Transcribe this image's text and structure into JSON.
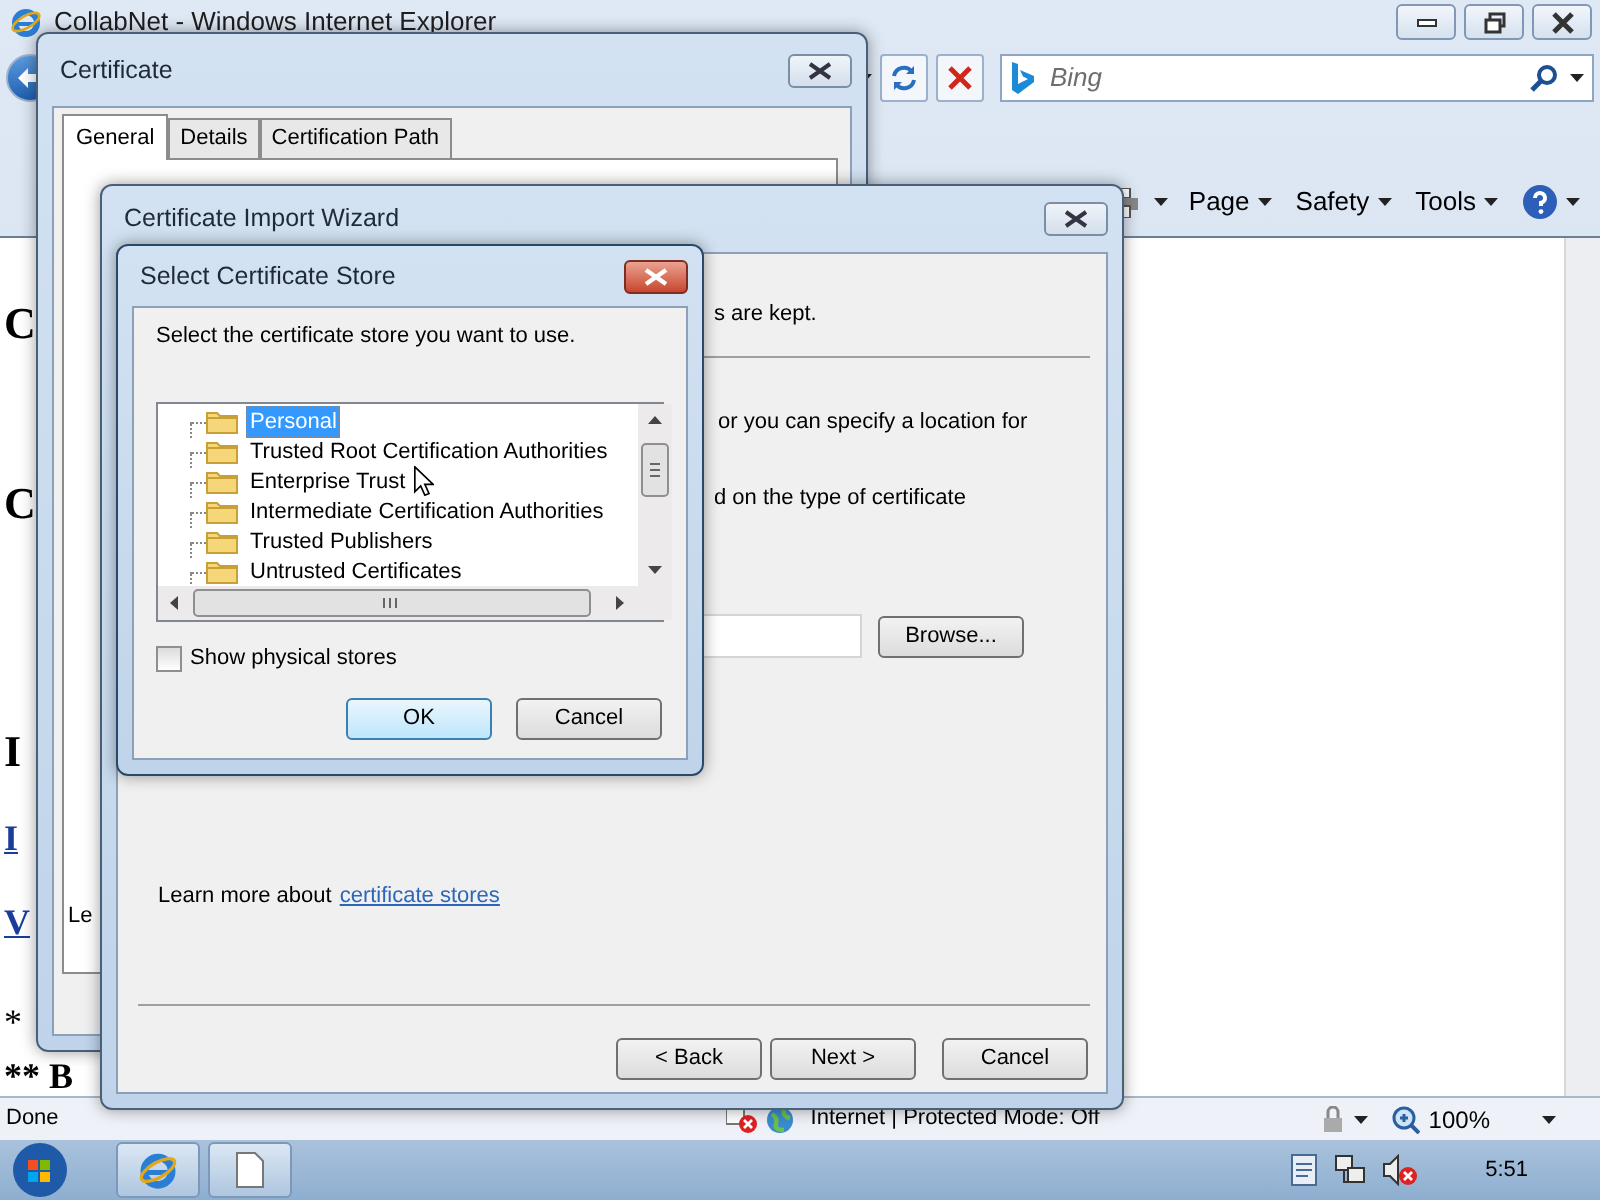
{
  "browser": {
    "title": "CollabNet - Windows Internet Explorer",
    "search": {
      "placeholder": "Bing"
    },
    "menus": [
      {
        "label": "Page"
      },
      {
        "label": "Safety"
      },
      {
        "label": "Tools"
      }
    ],
    "page_fragments": [
      {
        "kind": "heading",
        "text": "C"
      },
      {
        "kind": "heading",
        "text": "C"
      },
      {
        "kind": "heading",
        "text": "I"
      },
      {
        "kind": "link",
        "text": "I"
      },
      {
        "kind": "link",
        "text": "V"
      },
      {
        "kind": "text",
        "text": "*"
      },
      {
        "kind": "bold",
        "text": "** B"
      }
    ],
    "status_bar": {
      "status": "Done",
      "zone": "Internet | Protected Mode: Off",
      "zoom": "100%"
    }
  },
  "certificate_dialog": {
    "title": "Certificate",
    "tabs": [
      {
        "label": "General",
        "selected": true
      },
      {
        "label": "Details",
        "selected": false
      },
      {
        "label": "Certification Path",
        "selected": false
      }
    ],
    "body_text": "Le"
  },
  "import_wizard": {
    "title": "Certificate Import Wizard",
    "texts": [
      "s are kept.",
      "or you can specify a location for",
      "d on the type of certificate"
    ],
    "browse_button": "Browse...",
    "learn_more": "Learn more about",
    "learn_more_link": "certificate stores",
    "buttons": [
      "< Back",
      "Next >",
      "Cancel"
    ]
  },
  "store_dialog": {
    "title": "Select Certificate Store",
    "prompt": "Select the certificate store you want to use.",
    "stores": [
      {
        "label": "Personal",
        "selected": true
      },
      {
        "label": "Trusted Root Certification Authorities",
        "selected": false
      },
      {
        "label": "Enterprise Trust",
        "selected": false
      },
      {
        "label": "Intermediate Certification Authorities",
        "selected": false
      },
      {
        "label": "Trusted Publishers",
        "selected": false
      },
      {
        "label": "Untrusted Certificates",
        "selected": false
      }
    ],
    "show_physical_stores": {
      "label": "Show physical stores",
      "checked": false
    },
    "buttons": [
      "OK",
      "Cancel"
    ]
  },
  "taskbar": {
    "clock": "5:51"
  }
}
